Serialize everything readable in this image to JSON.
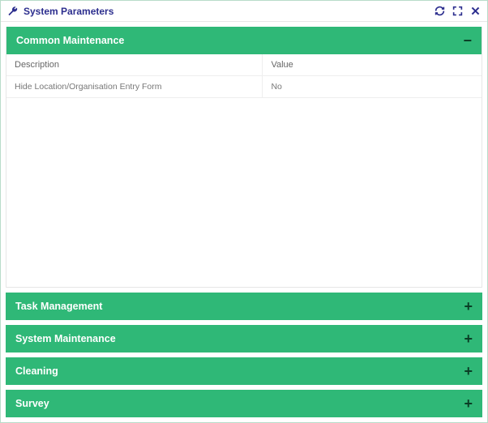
{
  "titlebar": {
    "title": "System Parameters"
  },
  "sections": {
    "open": {
      "title": "Common Maintenance",
      "toggle": "−",
      "columns": {
        "description": "Description",
        "value": "Value"
      },
      "rows": [
        {
          "description": "Hide Location/Organisation Entry Form",
          "value": "No"
        }
      ]
    },
    "closed": [
      {
        "title": "Task Management",
        "toggle": "+"
      },
      {
        "title": "System Maintenance",
        "toggle": "+"
      },
      {
        "title": "Cleaning",
        "toggle": "+"
      },
      {
        "title": "Survey",
        "toggle": "+"
      }
    ]
  }
}
